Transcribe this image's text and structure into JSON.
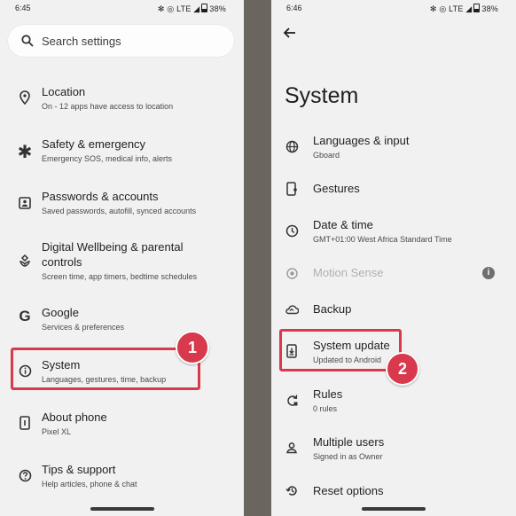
{
  "left": {
    "status": {
      "time": "6:45",
      "icons": "✻ ◎ LTE ◢",
      "battery": "38%"
    },
    "search": {
      "placeholder": "Search settings"
    },
    "items": [
      {
        "title": "Location",
        "sub": "On - 12 apps have access to location",
        "icon": "location-pin-icon"
      },
      {
        "title": "Safety & emergency",
        "sub": "Emergency SOS, medical info, alerts",
        "icon": "asterisk-icon"
      },
      {
        "title": "Passwords & accounts",
        "sub": "Saved passwords, autofill, synced accounts",
        "icon": "account-box-icon"
      },
      {
        "title": "Digital Wellbeing & parental",
        "title2": "controls",
        "sub": "Screen time, app timers, bedtime schedules",
        "icon": "wellbeing-icon"
      },
      {
        "title": "Google",
        "sub": "Services & preferences",
        "icon": "google-icon"
      },
      {
        "title": "System",
        "sub": "Languages, gestures, time, backup",
        "icon": "info-circle-icon"
      },
      {
        "title": "About phone",
        "sub": "Pixel    XL",
        "icon": "phone-icon"
      },
      {
        "title": "Tips & support",
        "sub": "Help articles, phone & chat",
        "icon": "help-icon"
      }
    ],
    "badge": "1"
  },
  "right": {
    "status": {
      "time": "6:46",
      "icons": "✻ ◎ LTE ◢",
      "battery": "38%"
    },
    "title": "System",
    "items": [
      {
        "title": "Languages & input",
        "sub": "Gboard",
        "icon": "globe-icon"
      },
      {
        "title": "Gestures",
        "sub": "",
        "icon": "gesture-phone-icon"
      },
      {
        "title": "Date & time",
        "sub": "GMT+01:00 West Africa Standard Time",
        "icon": "clock-icon"
      },
      {
        "title": "Motion Sense",
        "sub": "",
        "icon": "motion-sense-icon"
      },
      {
        "title": "Backup",
        "sub": "",
        "icon": "cloud-backup-icon"
      },
      {
        "title": "System update",
        "sub": "Updated to Android",
        "icon": "system-update-icon"
      },
      {
        "title": "Rules",
        "sub": "0 rules",
        "icon": "rules-icon"
      },
      {
        "title": "Multiple users",
        "sub": "Signed in as Owner",
        "icon": "person-icon"
      },
      {
        "title": "Reset options",
        "sub": "",
        "icon": "reset-icon"
      }
    ],
    "info_glyph": "i",
    "badge": "2"
  },
  "colors": {
    "highlight": "#d8394d",
    "panel": "#f1f1f1",
    "divider": "#6b655f"
  }
}
